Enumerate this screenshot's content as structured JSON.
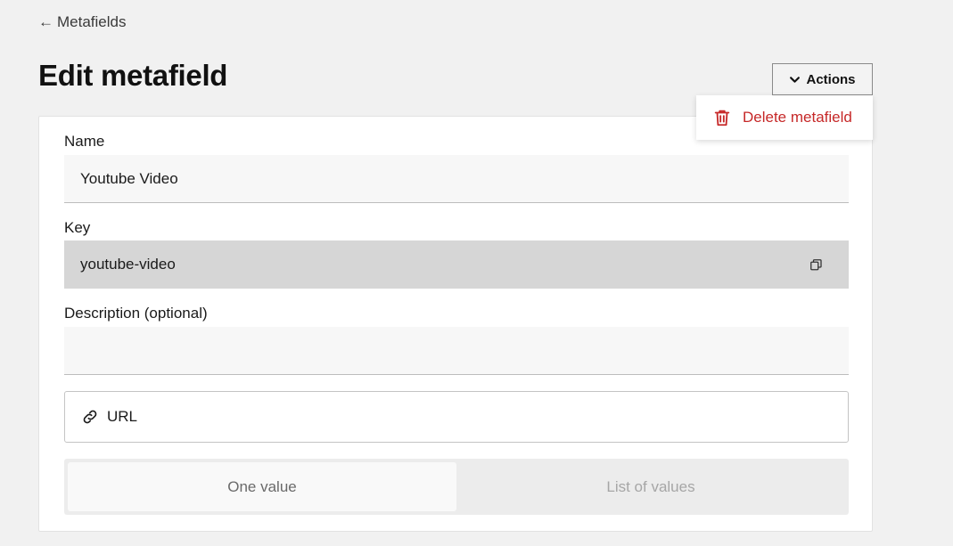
{
  "nav": {
    "back_arrow": "←",
    "back_label": "Metafields"
  },
  "header": {
    "title": "Edit metafield",
    "actions_label": "Actions"
  },
  "actions_menu": {
    "items": [
      {
        "label": "Delete metafield",
        "icon": "trash-icon",
        "color": "#c62828"
      }
    ]
  },
  "form": {
    "name": {
      "label": "Name",
      "value": "Youtube Video"
    },
    "key": {
      "label": "Key",
      "value": "youtube-video"
    },
    "description": {
      "label": "Description (optional)",
      "value": ""
    },
    "type": {
      "label": "URL",
      "icon": "link-icon"
    },
    "value_mode": {
      "options": [
        "One value",
        "List of values"
      ],
      "selected": "One value"
    }
  }
}
